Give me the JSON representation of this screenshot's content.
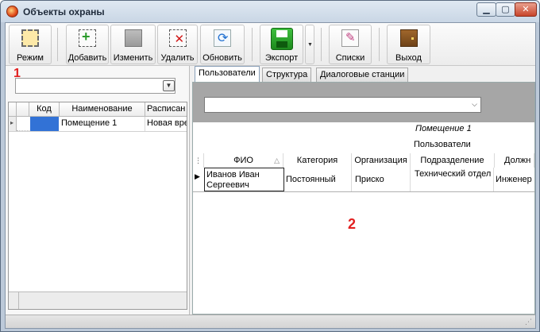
{
  "window": {
    "title": "Объекты охраны"
  },
  "toolbar": {
    "mode": "Режим",
    "add": "Добавить",
    "edit": "Изменить",
    "delete": "Удалить",
    "refresh": "Обновить",
    "export": "Экспорт",
    "lists": "Списки",
    "exit": "Выход"
  },
  "left": {
    "annotation": "1",
    "grid": {
      "headers": [
        "Код",
        "Наименование",
        "Расписан"
      ],
      "rows": [
        {
          "code": "",
          "name": "Помещение 1",
          "schedule": "Новая вре"
        }
      ]
    }
  },
  "right": {
    "tabs": [
      "Пользователи",
      "Структура",
      "Диалоговые станции"
    ],
    "caption_group": "Помещение 1",
    "caption_sub": "Пользователи",
    "columns": [
      "ФИО",
      "Категория",
      "Организация",
      "Подразделение",
      "Должн"
    ],
    "row": {
      "fio": "Иванов Иван Сергеевич",
      "category": "Постоянный",
      "org": "Приско",
      "dept": "Технический отдел",
      "position": "Инженер"
    },
    "annotation": "2"
  }
}
